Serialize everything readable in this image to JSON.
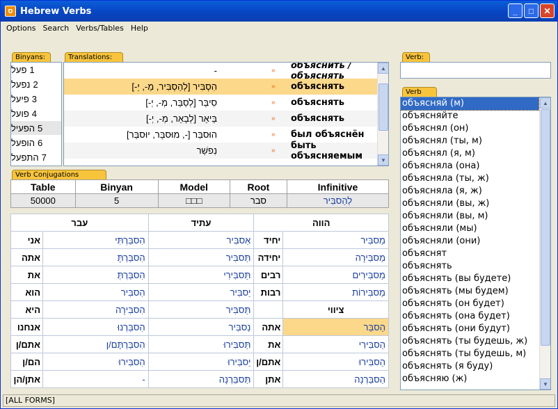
{
  "window": {
    "title": "Hebrew Verbs",
    "min": "_",
    "max": "□",
    "close": "✕"
  },
  "menu": [
    "Options",
    "Search",
    "Verbs/Tables",
    "Help"
  ],
  "binyans": {
    "label": "Binyans:",
    "items": [
      {
        "num": "1",
        "name": "פעל"
      },
      {
        "num": "2",
        "name": "נפעל"
      },
      {
        "num": "3",
        "name": "פיעל"
      },
      {
        "num": "4",
        "name": "פועל"
      },
      {
        "num": "5",
        "name": "הפעיל"
      },
      {
        "num": "6",
        "name": "הופעל"
      },
      {
        "num": "7",
        "name": "התפעל"
      }
    ],
    "selected": 4
  },
  "translations": {
    "label": "Translations:",
    "rows": [
      {
        "heb": "-",
        "ru": "объяснить / объяснять",
        "italic": true
      },
      {
        "heb": "הִסְבִּיר [לְהַסְבִּיר, מַ-, יַ-]",
        "ru": "объяснять"
      },
      {
        "heb": "סִיבֵּר [לְסַבֵּר, מְ-, יְ-]",
        "ru": "объяснять"
      },
      {
        "heb": "בֵּיאֵר [לְבָאֵר, מְ-, יְ-]",
        "ru": "объяснять"
      },
      {
        "heb": "הוּסבַּר [-, מוּסבָּר, יוּסבַּר]",
        "ru": "был объяснён"
      },
      {
        "heb": "נִפשַׁר",
        "ru": "быть объясняемым"
      }
    ],
    "selected": 1
  },
  "conjugations_label": "Verb Conjugations Forms:",
  "info": {
    "headers": [
      "Table",
      "Binyan",
      "Model",
      "Root",
      "Infinitive"
    ],
    "values": [
      "50000",
      "5",
      "□□□",
      "סבר",
      "לְהַסבִּיר"
    ]
  },
  "conj": {
    "headers": {
      "past": "עבר",
      "future": "עתיד",
      "present": "הווה",
      "imperative": "ציווי"
    },
    "past": [
      [
        "אני",
        "הִסבַּרְתִּי"
      ],
      [
        "אתה",
        "הִסבַּרְתָּ"
      ],
      [
        "את",
        "הִסבַּרְתְּ"
      ],
      [
        "הוא",
        "הִסבִּיר"
      ],
      [
        "היא",
        "הִסבִּירָה"
      ],
      [
        "אנחנו",
        "הִסבַּרְנוּ"
      ],
      [
        "אתם/ן",
        "הִסבַּרְתֶּם/ן"
      ],
      [
        "הם/ן",
        "הִסבִּירוּ"
      ],
      [
        "אתן/הן",
        "-"
      ]
    ],
    "future": [
      "אַסבִּיר",
      "תַּסבִּיר",
      "תַּסבִּירִי",
      "יַסבִּיר",
      "תַּסבִּיר",
      "נַסבִּיר",
      "תַּסבִּירוּ",
      "יַסבִּירוּ",
      "תַּסבֵּרְנָה"
    ],
    "present": [
      [
        "יחיד",
        "מַסבִּיר"
      ],
      [
        "יחידה",
        "מַסבִּירָה"
      ],
      [
        "רבים",
        "מַסבִּירִים"
      ],
      [
        "רבות",
        "מַסבִּירוֹת"
      ]
    ],
    "imperative": [
      [
        "אתה",
        "הַסבֵּר"
      ],
      [
        "את",
        "הַסבִּירִי"
      ],
      [
        "אתם/ן",
        "הַסבִּירוּ"
      ],
      [
        "אתן",
        "הַסבֵּרְנָה"
      ]
    ]
  },
  "verb": {
    "label": "Verb:",
    "value": ""
  },
  "verblist": {
    "label": "Verb list:",
    "items": [
      "объясняй (м)",
      "объясняйте",
      "объяснял (он)",
      "объяснял (ты, м)",
      "объяснял (я, м)",
      "объясняла (она)",
      "объясняла (ты, ж)",
      "объясняла (я, ж)",
      "объясняли (вы, ж)",
      "объясняли (вы, м)",
      "объясняли (мы)",
      "объясняли (они)",
      "объяснят",
      "объяснять",
      "объяснять (вы будете)",
      "объяснять (мы будем)",
      "объяснять (он будет)",
      "объяснять (она будет)",
      "объяснять (они будут)",
      "объяснять (ты будешь, ж)",
      "объяснять (ты будешь, м)",
      "объяснять (я буду)",
      "объясняю (ж)"
    ],
    "selected": 0
  },
  "status": "[ALL FORMS]"
}
